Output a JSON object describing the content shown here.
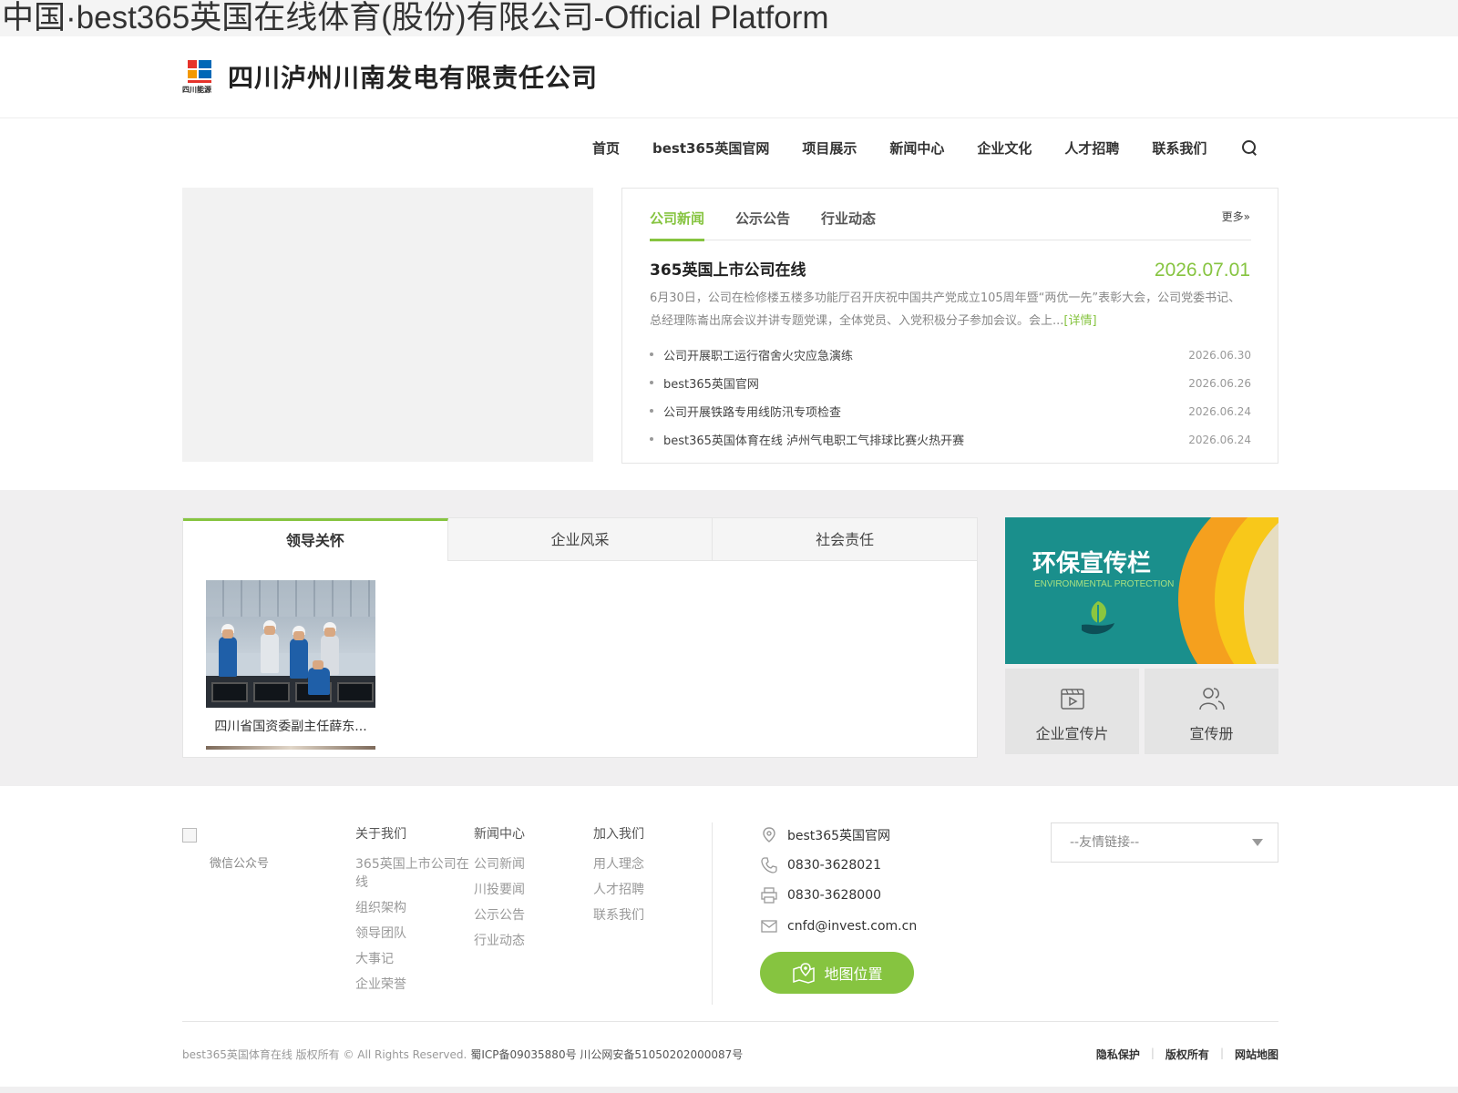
{
  "window": {
    "title": "中国·best365英国在线体育(股份)有限公司-Official Platform"
  },
  "header": {
    "logo_caption": "四川能源",
    "company_name": "四川泸州川南发电有限责任公司"
  },
  "nav": {
    "items": [
      "首页",
      "best365英国官网",
      "项目展示",
      "新闻中心",
      "企业文化",
      "人才招聘",
      "联系我们"
    ],
    "search_icon": "search-icon"
  },
  "news": {
    "tabs": [
      "公司新闻",
      "公示公告",
      "行业动态"
    ],
    "active_tab": "公司新闻",
    "more": "更多»",
    "headline": {
      "title": "365英国上市公司在线",
      "date": "2026.07.01",
      "summary": "6月30日，公司在检修楼五楼多功能厅召开庆祝中国共产党成立105周年暨“两优一先”表彰大会，公司党委书记、总经理陈崙出席会议并讲专题党课，全体党员、入党积极分子参加会议。会上...",
      "detail": "[详情]"
    },
    "list": [
      {
        "title": "公司开展职工运行宿舍火灾应急演练",
        "date": "2026.06.30"
      },
      {
        "title": "best365英国官网",
        "date": "2026.06.26"
      },
      {
        "title": "公司开展铁路专用线防汛专项检查",
        "date": "2026.06.24"
      },
      {
        "title": "best365英国体育在线 泸州气电职工气排球比赛火热开赛",
        "date": "2026.06.24"
      }
    ]
  },
  "feature": {
    "tabs": [
      "领导关怀",
      "企业风采",
      "社会责任"
    ],
    "active_tab": "领导关怀",
    "card_caption": "四川省国资委副主任薛东..."
  },
  "env": {
    "title": "环保宣传栏",
    "subtitle": "ENVIRONMENTAL PROTECTION"
  },
  "quick_links": [
    {
      "label": "企业宣传片",
      "icon": "video-icon"
    },
    {
      "label": "宣传册",
      "icon": "people-icon"
    }
  ],
  "footer": {
    "qr_caption": "微信公众号",
    "columns": [
      {
        "heading": "关于我们",
        "links": [
          "365英国上市公司在线",
          "组织架构",
          "领导团队",
          "大事记",
          "企业荣誉"
        ]
      },
      {
        "heading": "新闻中心",
        "links": [
          "公司新闻",
          "川投要闻",
          "公示公告",
          "行业动态"
        ]
      },
      {
        "heading": "加入我们",
        "links": [
          "用人理念",
          "人才招聘",
          "联系我们"
        ]
      }
    ],
    "contact": [
      {
        "icon": "location-icon",
        "text": "best365英国官网"
      },
      {
        "icon": "phone-icon",
        "text": "0830-3628021"
      },
      {
        "icon": "printer-icon",
        "text": "0830-3628000"
      },
      {
        "icon": "mail-icon",
        "text": "cnfd@invest.com.cn"
      }
    ],
    "map_button": "地图位置",
    "friend_links_placeholder": "--友情链接--",
    "copyright": "best365英国体育在线 版权所有 © All Rights Reserved.",
    "icp": "蜀ICP备09035880号  川公网安备51050202000087号",
    "bottom_links": [
      "隐私保护",
      "版权所有",
      "网站地图"
    ]
  },
  "colors": {
    "accent": "#86c440",
    "band": "#f0eff0",
    "env_teal": "#1a8f8c",
    "env_orange": "#f5a01e"
  }
}
